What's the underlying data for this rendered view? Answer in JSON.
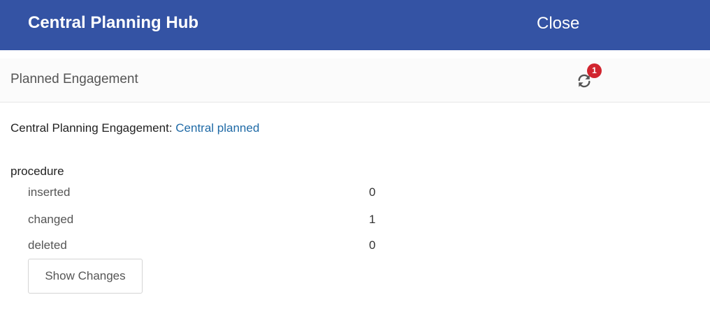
{
  "header": {
    "title": "Central Planning Hub",
    "close_label": "Close",
    "background": "#3453a4"
  },
  "section": {
    "title": "Planned Engagement",
    "sync_icon": "sync-icon",
    "badge_count": "1",
    "badge_color": "#d1252f"
  },
  "engagement": {
    "label": "Central Planning Engagement: ",
    "link_text": "Central planned",
    "link_color": "#1f6aa6"
  },
  "procedure": {
    "heading": "procedure",
    "rows": [
      {
        "label": "inserted",
        "value": "0"
      },
      {
        "label": "changed",
        "value": "1"
      },
      {
        "label": "deleted",
        "value": "0"
      }
    ],
    "show_changes_label": "Show Changes"
  }
}
